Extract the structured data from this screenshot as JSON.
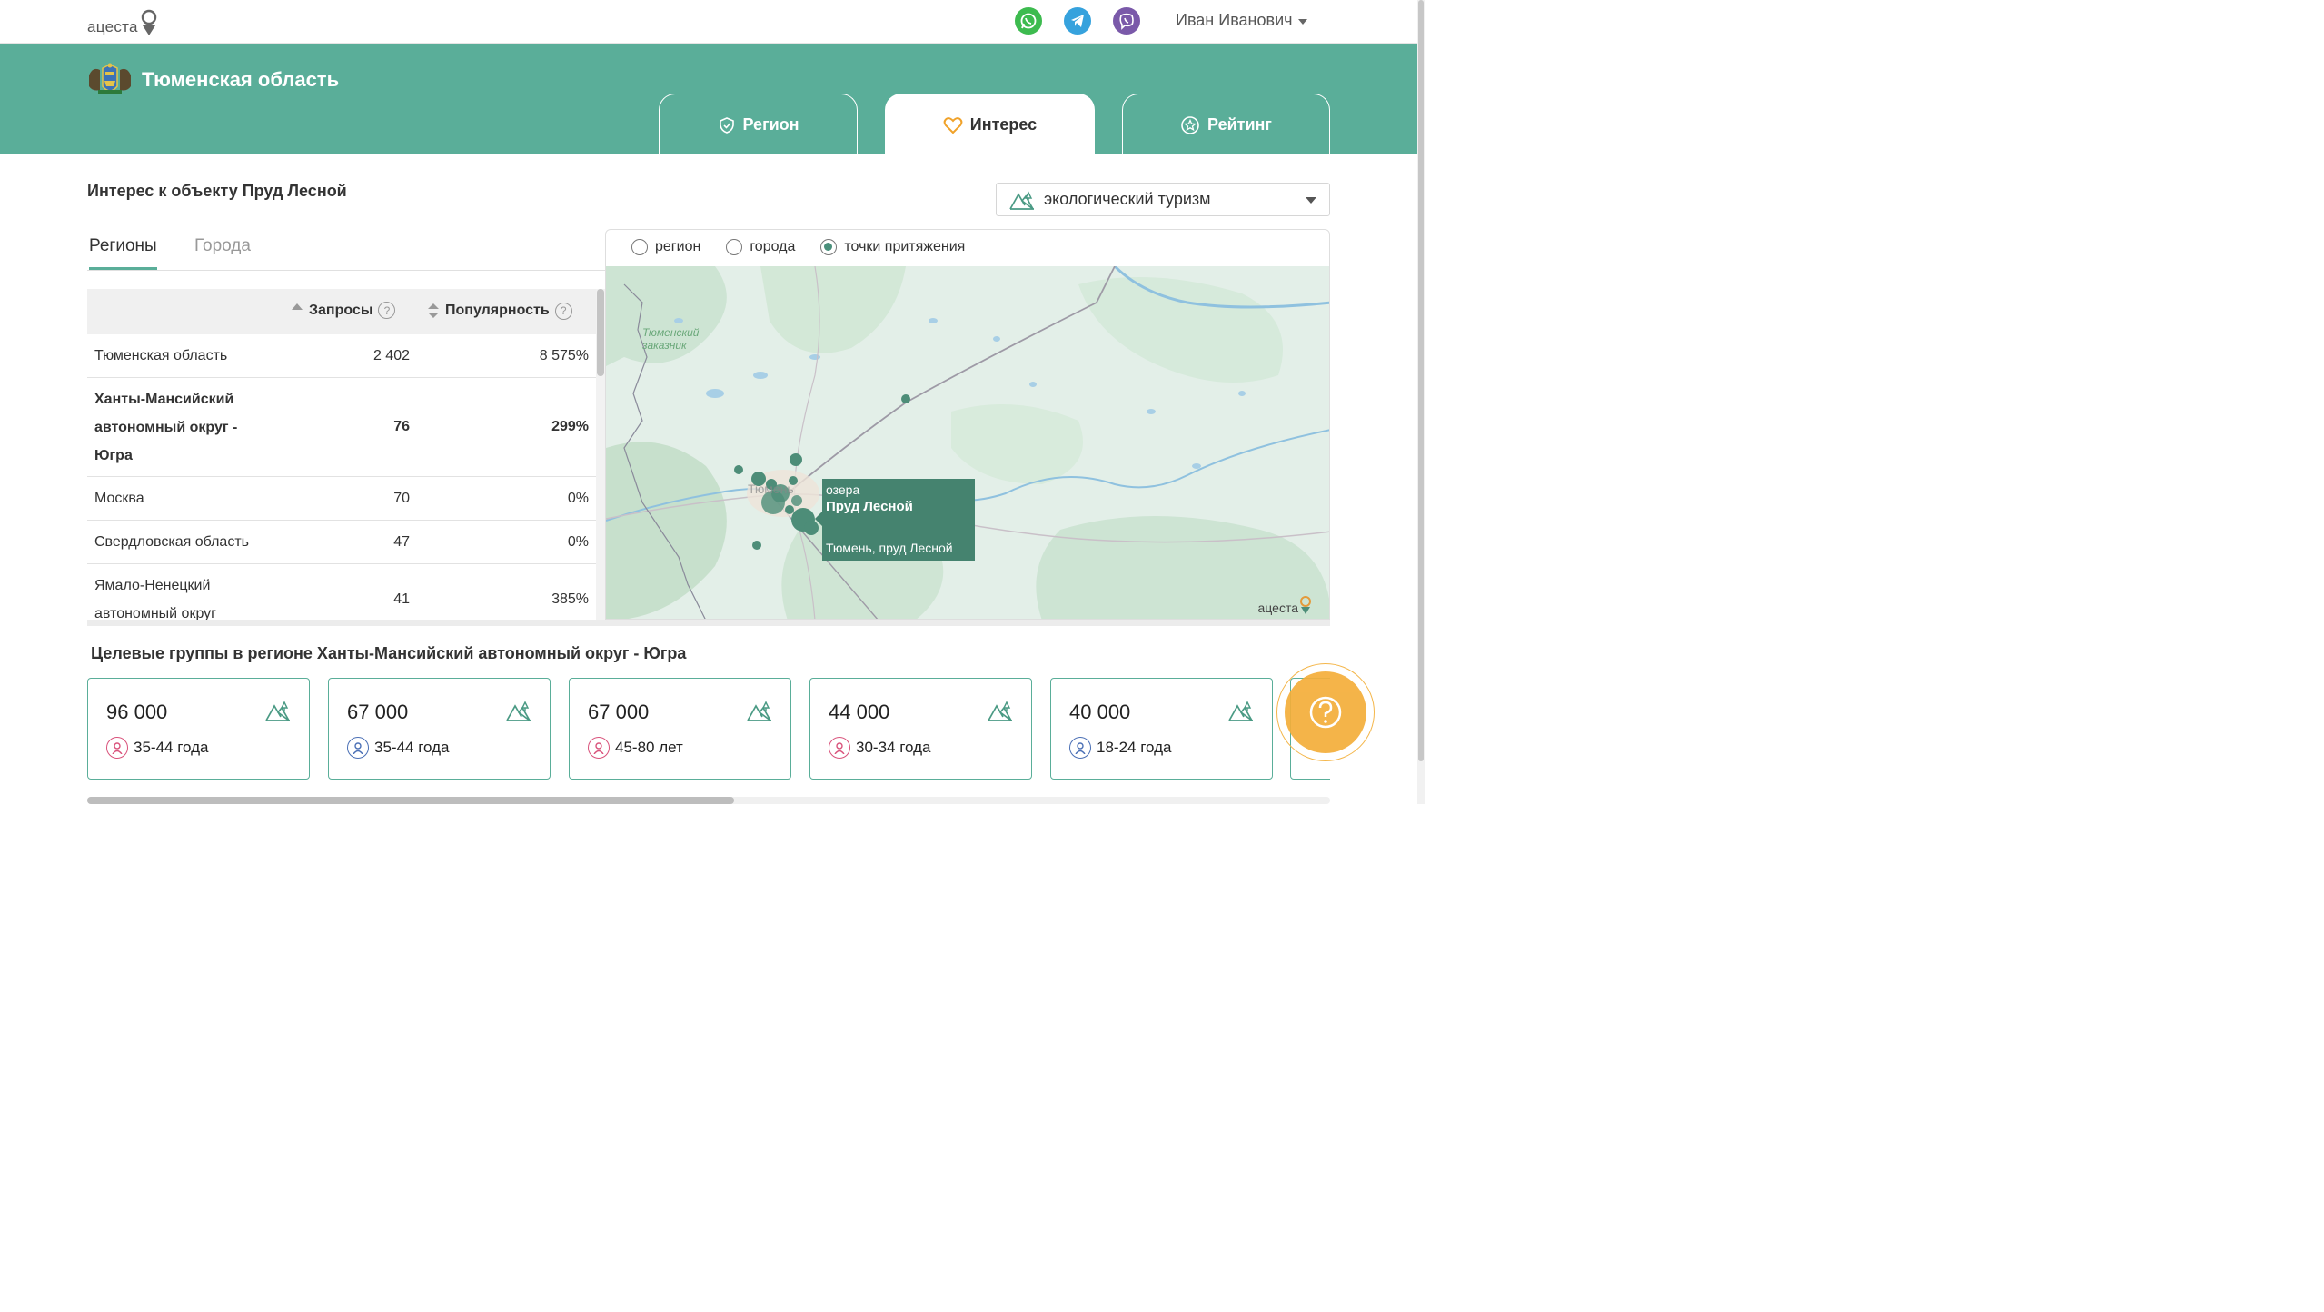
{
  "header": {
    "logo_text": "ацеста",
    "user_name": "Иван Иванович",
    "messengers": [
      "whatsapp-icon",
      "telegram-icon",
      "viber-icon"
    ]
  },
  "region": {
    "name": "Тюменская область"
  },
  "tabs": [
    {
      "label": "Регион",
      "icon": "shield-icon",
      "active": false
    },
    {
      "label": "Интерес",
      "icon": "heart-icon",
      "active": true
    },
    {
      "label": "Рейтинг",
      "icon": "star-icon",
      "active": false
    }
  ],
  "object_title": "Интерес к объекту Пруд Лесной",
  "category_select": {
    "value": "экологический туризм",
    "icon": "mountain-tree-icon"
  },
  "subtabs": [
    {
      "label": "Регионы",
      "active": true
    },
    {
      "label": "Города",
      "active": false
    }
  ],
  "table": {
    "columns": [
      "Запросы",
      "Популярность"
    ],
    "rows": [
      {
        "name": "Тюменская область",
        "requests": "2 402",
        "popularity": "8 575%",
        "bold": false
      },
      {
        "name": "Ханты-Мансийский автономный округ - Югра",
        "requests": "76",
        "popularity": "299%",
        "bold": true
      },
      {
        "name": "Москва",
        "requests": "70",
        "popularity": "0%",
        "bold": false
      },
      {
        "name": "Свердловская область",
        "requests": "47",
        "popularity": "0%",
        "bold": false
      },
      {
        "name": "Ямало-Ненецкий автономный округ",
        "requests": "41",
        "popularity": "385%",
        "bold": false
      }
    ]
  },
  "map": {
    "modes": [
      {
        "label": "регион",
        "checked": false
      },
      {
        "label": "города",
        "checked": false
      },
      {
        "label": "точки притяжения",
        "checked": true
      }
    ],
    "labels": {
      "reserve": "Тюменский заказник",
      "city": "Тюмень"
    },
    "tooltip": {
      "category": "озера",
      "name": "Пруд Лесной",
      "address": "Тюмень, пруд Лесной"
    },
    "logo_text": "ацеста"
  },
  "groups": {
    "title": "Целевые группы в регионе Ханты-Мансийский автономный округ - Югра",
    "cards": [
      {
        "count": "96 000",
        "age": "35-44 года",
        "gender": "female"
      },
      {
        "count": "67 000",
        "age": "35-44 года",
        "gender": "male"
      },
      {
        "count": "67 000",
        "age": "45-80 лет",
        "gender": "female"
      },
      {
        "count": "44 000",
        "age": "30-34 года",
        "gender": "female"
      },
      {
        "count": "40 000",
        "age": "18-24 года",
        "gender": "male"
      }
    ]
  },
  "colors": {
    "brand_green": "#5aae99",
    "dark_green": "#45836f",
    "female": "#d9527b",
    "male": "#4a6fb5",
    "help": "#f4ae3a"
  }
}
